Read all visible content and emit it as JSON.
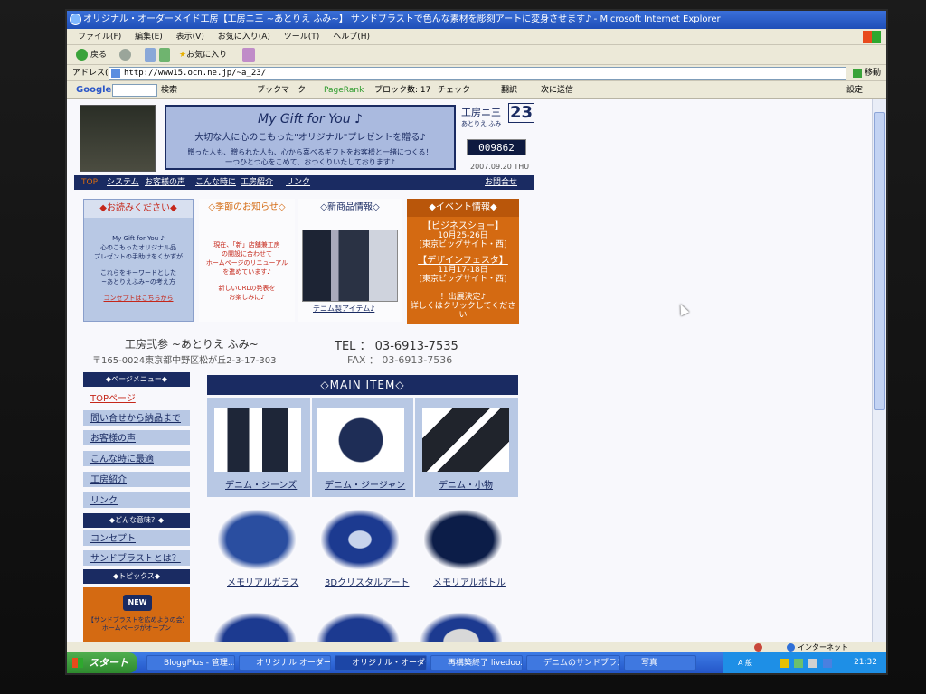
{
  "window": {
    "title": "オリジナル・オーダーメイド工房【工房ニ三 ~あとりえ ふみ~】 サンドブラストで色んな素材を彫刻アートに変身させます♪ - Microsoft Internet Explorer"
  },
  "menubar": {
    "items": [
      "ファイル(F)",
      "編集(E)",
      "表示(V)",
      "お気に入り(A)",
      "ツール(T)",
      "ヘルプ(H)"
    ]
  },
  "toolbar": {
    "back_label": "戻る",
    "favorites_label": "お気に入り"
  },
  "address": {
    "label": "アドレス(D)",
    "url": "http://www15.ocn.ne.jp/~a_23/",
    "go_label": "移動"
  },
  "google_bar": {
    "brand": "Google",
    "search_label": "検索",
    "bookmarks_label": "ブックマーク",
    "pagerank_label": "PageRank",
    "popup_blocked_label": "ブロック数: 17",
    "check_label": "チェック",
    "translate_label": "翻訳",
    "send_label": "次に送信",
    "settings_label": "設定"
  },
  "page": {
    "banner": {
      "title": "My Gift for You ♪",
      "subtitle": "大切な人に心のこもった\"オリジナル\"プレゼントを贈る♪",
      "line1": "贈った人も、贈られた人も、心から喜べるギフトをお客様と一緒につくる！",
      "line2": "一つひとつ心をこめて、おつくりいたしております♪"
    },
    "logo": {
      "name": "工房ニ三",
      "number": "23",
      "ruby": "あとりえ ふみ",
      "counter": "009862",
      "date": "2007.09.20 THU"
    },
    "nav": {
      "items": [
        "TOP",
        "システム",
        "お客様の声",
        "こんな時に",
        "工房紹介",
        "リンク"
      ],
      "contact": "お問合せ"
    },
    "box1": {
      "head": "◆お読みください◆",
      "line1": "My Gift for You ♪",
      "line2": "心のこもったオリジナル品",
      "line3": "プレゼントの手助けをくかずが",
      "line4": "これらをキーワードとした",
      "line5": "~あとりえふみ~の考え方",
      "link": "コンセプトはこちらから"
    },
    "box2": {
      "head": "◇季節のお知らせ◇",
      "line1": "現在、「新」店舗兼工房",
      "line2": "の開設に合わせて",
      "line3": "ホームページのリニューアル",
      "line4": "を進めています♪",
      "line5": "新しいURLの発表を",
      "line6": "お楽しみに♪"
    },
    "box3": {
      "head": "◇新商品情報◇",
      "caption": "デニム製アイテム♪"
    },
    "box4": {
      "head": "◆イベント情報◆",
      "event1": "【ビジネスショー】",
      "event1_date": "10月25-26日",
      "event1_place": "[東京ビッグサイト・西]",
      "event2": "【デザインフェスタ】",
      "event2_date": "11月17-18日",
      "event2_place": "[東京ビッグサイト・西]",
      "note1": "！出展決定♪",
      "note2": "詳しくはクリックしてください"
    },
    "address_block": {
      "name": "工房弐参 ~あとりえ ふみ~",
      "postal": "〒165-0024東京都中野区松が丘2-3-17-303",
      "tel": "TEL ： 03-6913-7535",
      "fax": "FAX ： 03-6913-7536"
    },
    "side_menu": {
      "head1": "◆ページメニュー◆",
      "items1": [
        "TOPページ",
        "問い合せから納品まで",
        "お客様の声",
        "こんな時に最適",
        "工房紹介",
        "リンク"
      ],
      "head2": "◆どんな意味？◆",
      "items2": [
        "コンセプト",
        "サンドブラストとは？"
      ],
      "head3": "◆トピックス◆",
      "new_badge": "NEW",
      "topic_text": "【サンドブラストを広めようの会】ホームページがオープン"
    },
    "main_item": {
      "head": "◇MAIN ITEM◇",
      "row1": [
        "デニム・ジーンズ",
        "デニム・ジージャン",
        "デニム・小物"
      ],
      "row2": [
        "メモリアルガラス",
        "3Dクリスタルアート",
        "メモリアルボトル"
      ]
    }
  },
  "statusbar": {
    "zone": "インターネット"
  },
  "taskbar": {
    "start": "スタート",
    "tasks": [
      "BloggPlus - 管理...",
      "オリジナル オーダーメ...",
      "オリジナル・オーダーメ...",
      "再構築終了 livedoo...",
      "デニムのサンドブラス...",
      "写真"
    ],
    "ime": "A 般",
    "clock": "21:32"
  },
  "colors": {
    "navy": "#1a2b62",
    "orange": "#d46a12",
    "light_blue": "#b8c8e4",
    "banner_blue": "#aabadf"
  }
}
